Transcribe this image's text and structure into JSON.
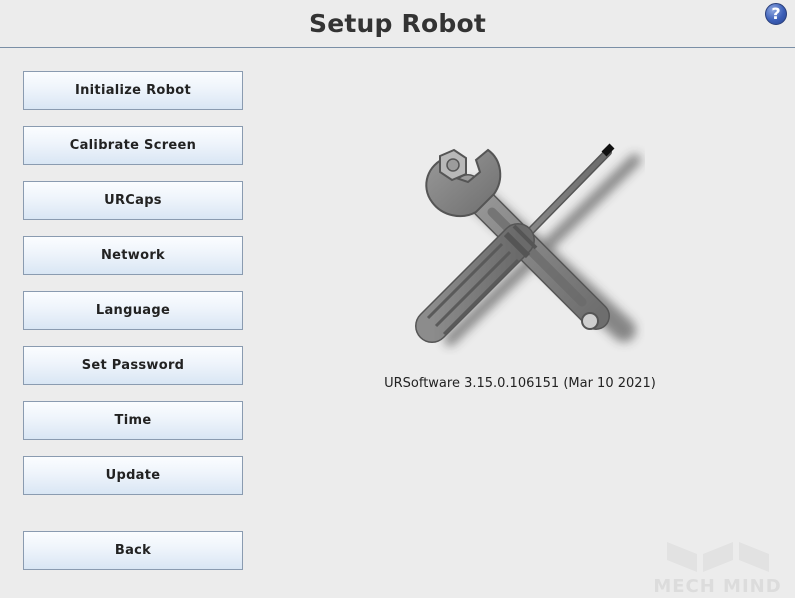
{
  "header": {
    "title": "Setup Robot",
    "help_symbol": "?"
  },
  "menu": {
    "items": [
      {
        "label": "Initialize Robot"
      },
      {
        "label": "Calibrate Screen"
      },
      {
        "label": "URCaps"
      },
      {
        "label": "Network"
      },
      {
        "label": "Language"
      },
      {
        "label": "Set Password"
      },
      {
        "label": "Time"
      },
      {
        "label": "Update"
      }
    ],
    "back_label": "Back"
  },
  "main": {
    "illustration_icon": "wrench-screwdriver-icon",
    "version_text": "URSoftware 3.15.0.106151 (Mar 10 2021)"
  },
  "watermark": {
    "text": "MECH MIND"
  },
  "colors": {
    "background": "#ececec",
    "button_gradient_top": "#fbfdff",
    "button_gradient_bottom": "#d9e6f4",
    "button_border": "#8a9bb0",
    "header_rule": "#7a8fa6",
    "help_icon_blue": "#3c5fb8"
  }
}
